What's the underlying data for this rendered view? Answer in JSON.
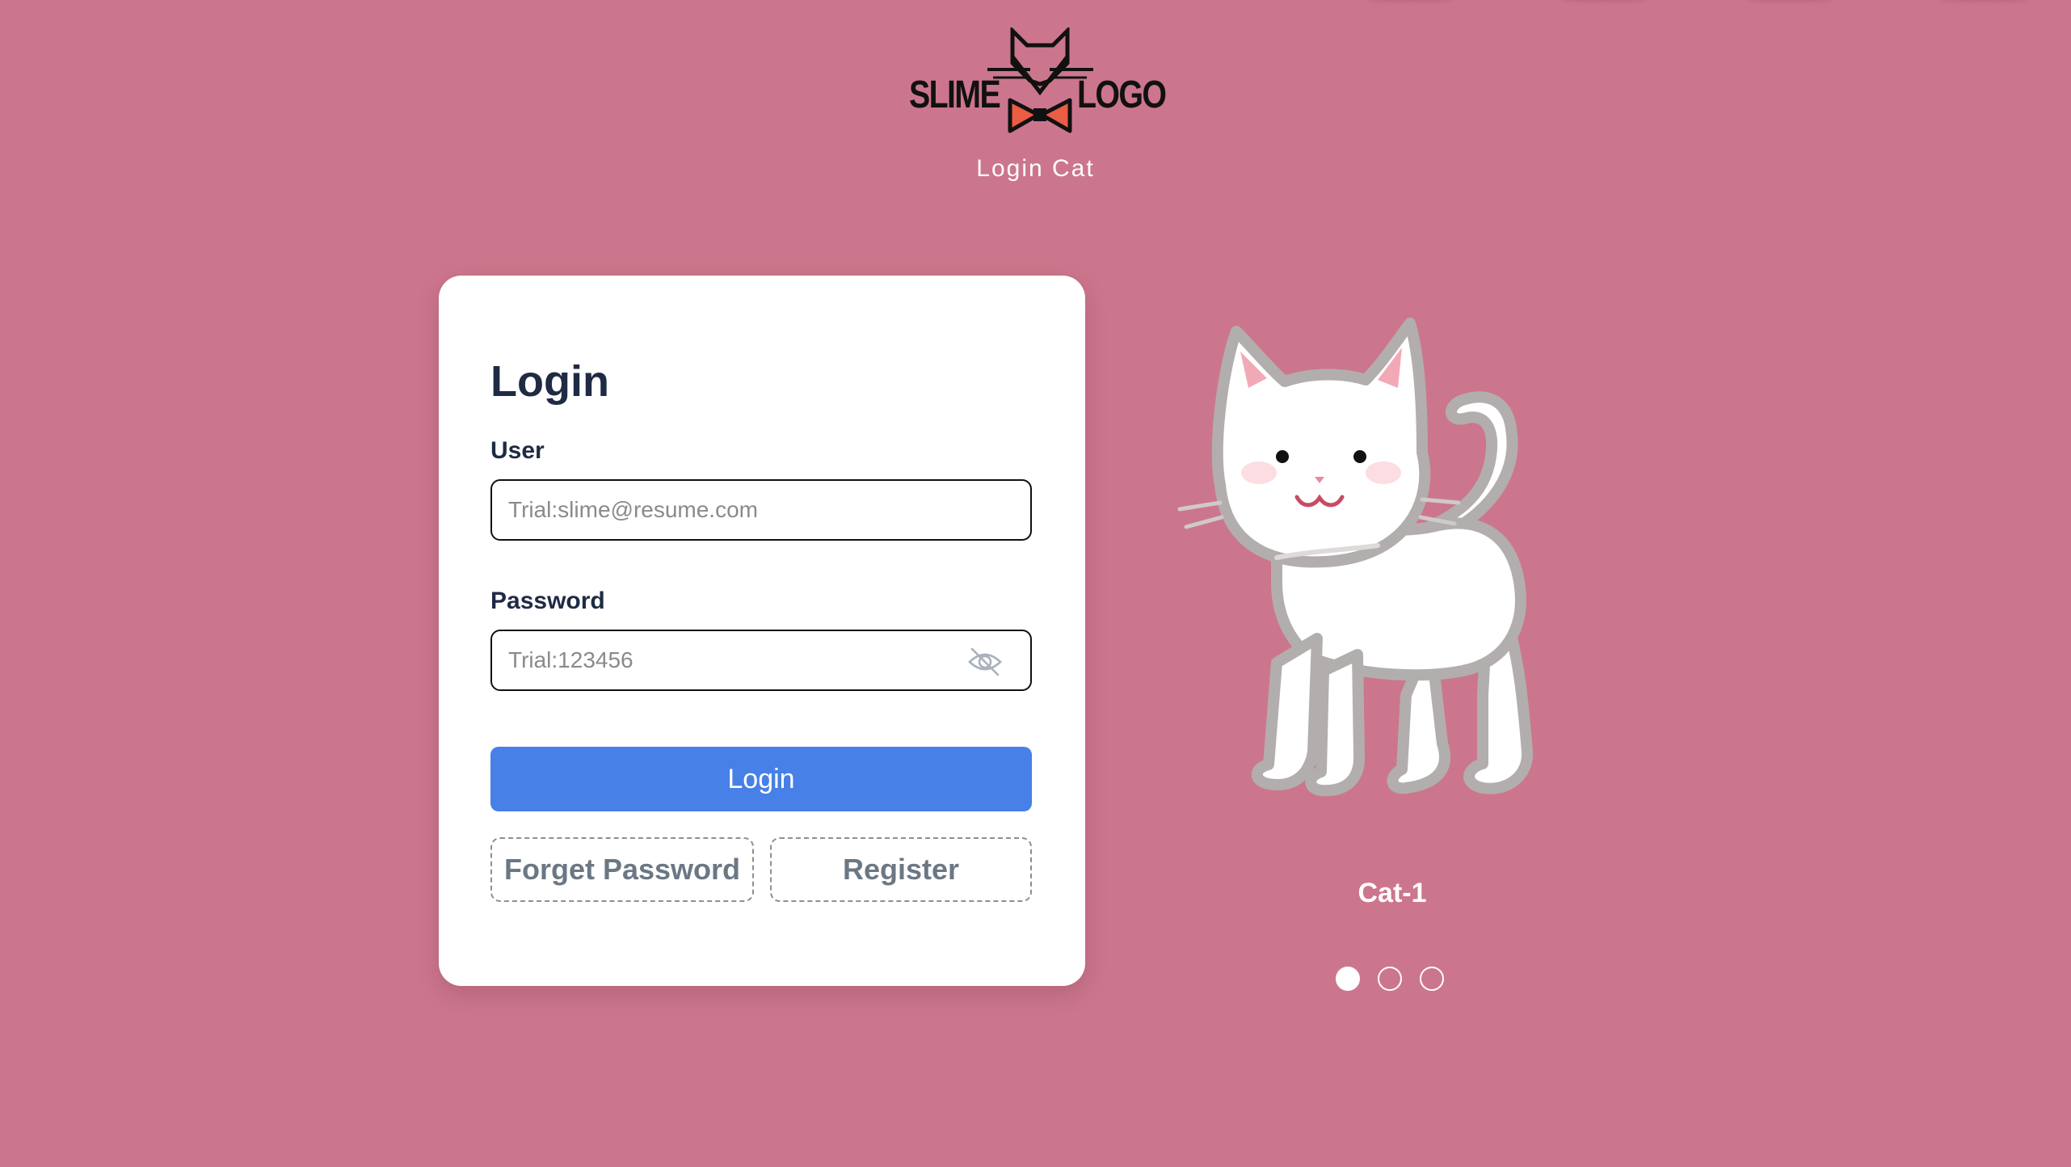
{
  "brand": {
    "logo_left": "SLIME",
    "logo_right": "LOGO",
    "subtitle": "Login Cat"
  },
  "login_card": {
    "title": "Login",
    "user_label": "User",
    "user_placeholder": "Trial:slime@resume.com",
    "user_value": "",
    "password_label": "Password",
    "password_placeholder": "Trial:123456",
    "password_value": "",
    "password_toggle_icon": "eye-off-icon",
    "login_button": "Login",
    "forget_password_button": "Forget Password",
    "register_button": "Register"
  },
  "carousel": {
    "caption": "Cat-1",
    "slide_count": 3,
    "active_index": 0,
    "image_icon": "cat-illustration"
  },
  "colors": {
    "background": "#cc768d",
    "primary": "#4780e6",
    "card": "#ffffff",
    "text_dark": "#1f2a44"
  }
}
